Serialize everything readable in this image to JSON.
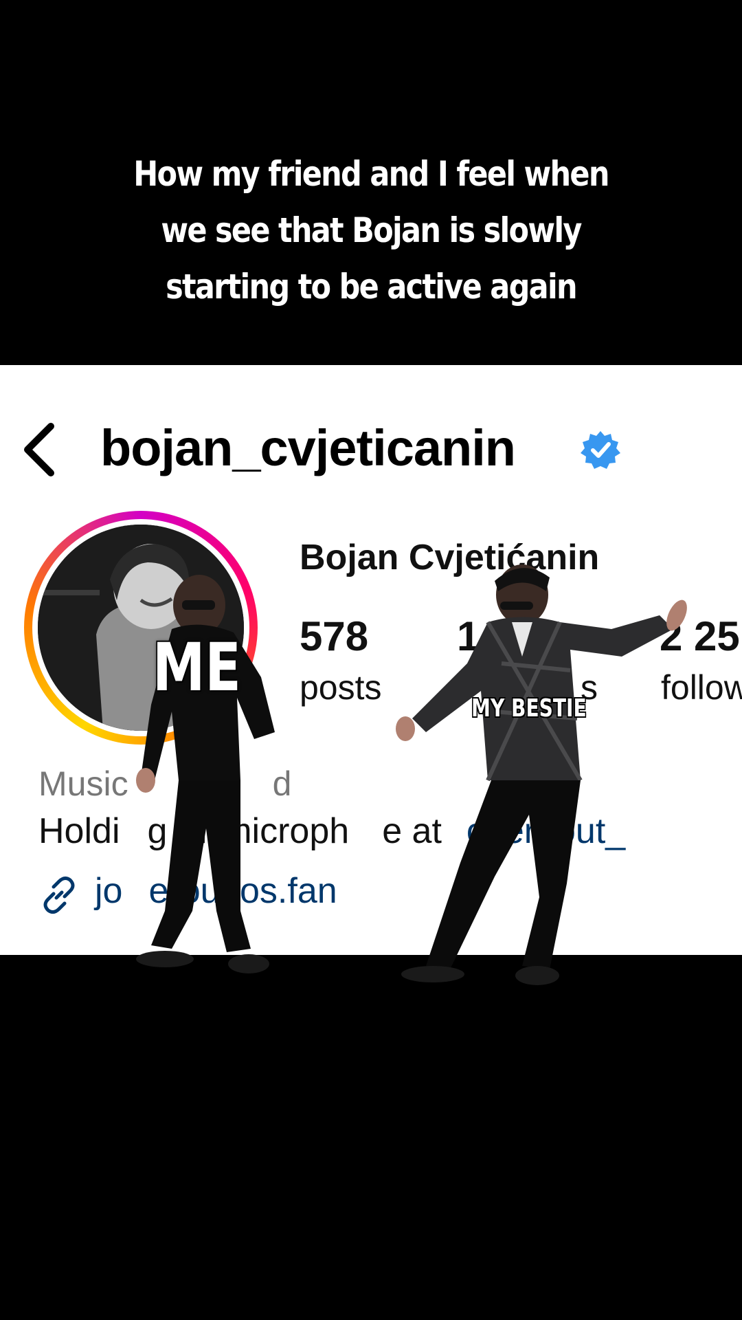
{
  "caption": {
    "line1": "How my friend and I feel when",
    "line2": "we see that Bojan is slowly",
    "line3": "starting to be active again"
  },
  "profile": {
    "username": "bojan_cvjeticanin",
    "full_name": "Bojan Cvjetićanin",
    "stats": [
      {
        "value": "578",
        "label": "posts"
      },
      {
        "value": "1",
        "label": "s"
      },
      {
        "value": "2 25",
        "label": "follow"
      }
    ],
    "category": "Music",
    "category_tail": "d",
    "bio_start": "Holdi",
    "bio_mid1": "g th",
    "bio_mid2": "microph",
    "bio_mid3": "e at",
    "bio_mention": "oker_out_",
    "link_start": "jo",
    "link_mid": "erou",
    "link_end": ".os.fan"
  },
  "overlay_labels": {
    "me": "ME",
    "bestie": "MY BESTIE"
  },
  "icons": {
    "back": "chevron-left-icon",
    "verified": "verified-badge-icon",
    "link": "link-icon"
  },
  "colors": {
    "background": "#000000",
    "verified_blue": "#3897f0",
    "link_blue": "#00376b"
  }
}
